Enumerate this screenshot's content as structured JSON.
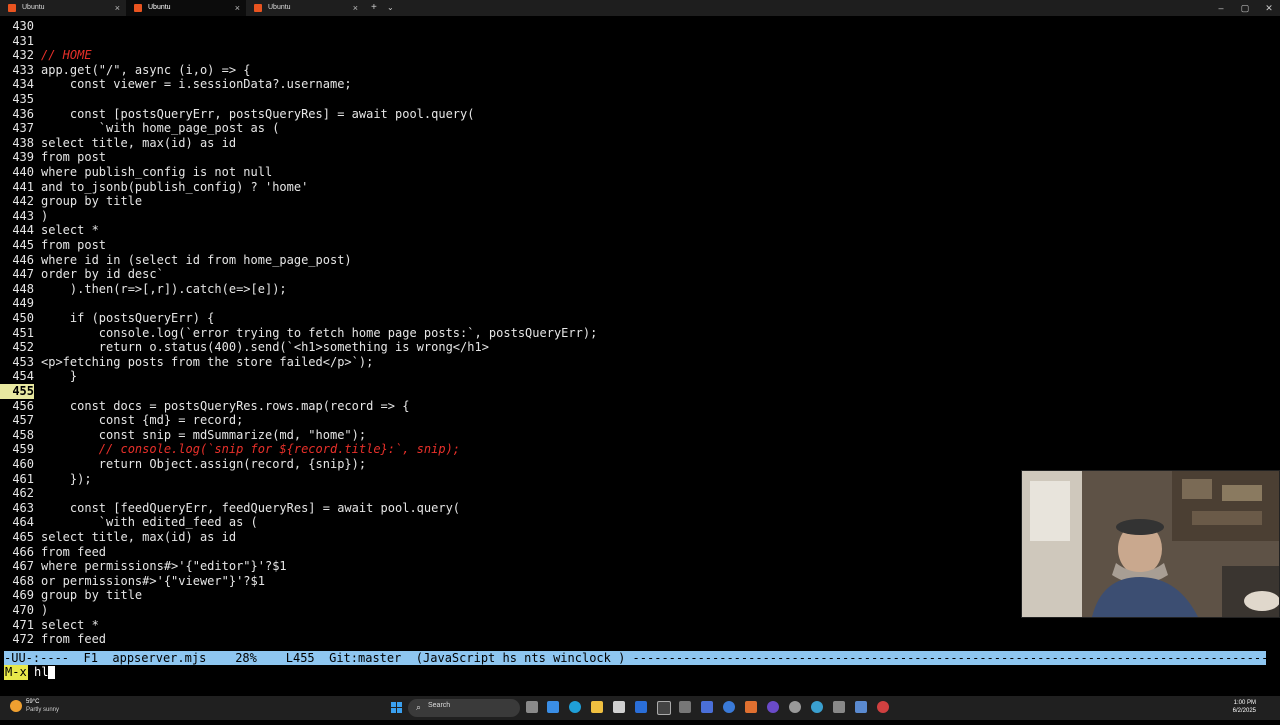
{
  "tabs": [
    {
      "label": "Ubuntu",
      "active": false
    },
    {
      "label": "Ubuntu",
      "active": true
    },
    {
      "label": "Ubuntu",
      "active": false
    }
  ],
  "tabbar": {
    "new_tab": "+",
    "dropdown": "⌄",
    "close": "×"
  },
  "window": {
    "minimize": "–",
    "maximize": "▢",
    "close": "✕"
  },
  "editor": {
    "current_line": "455",
    "lines": [
      {
        "n": "430",
        "code": ""
      },
      {
        "n": "431",
        "code": ""
      },
      {
        "n": "432",
        "code": "// HOME",
        "cls": "comment"
      },
      {
        "n": "433",
        "code": "app.get(\"/\", async (i,o) => {"
      },
      {
        "n": "434",
        "code": "    const viewer = i.sessionData?.username;"
      },
      {
        "n": "435",
        "code": ""
      },
      {
        "n": "436",
        "code": "    const [postsQueryErr, postsQueryRes] = await pool.query("
      },
      {
        "n": "437",
        "code": "        `with home_page_post as ("
      },
      {
        "n": "438",
        "code": "select title, max(id) as id"
      },
      {
        "n": "439",
        "code": "from post"
      },
      {
        "n": "440",
        "code": "where publish_config is not null"
      },
      {
        "n": "441",
        "code": "and to_jsonb(publish_config) ? 'home'"
      },
      {
        "n": "442",
        "code": "group by title"
      },
      {
        "n": "443",
        "code": ")"
      },
      {
        "n": "444",
        "code": "select *"
      },
      {
        "n": "445",
        "code": "from post"
      },
      {
        "n": "446",
        "code": "where id in (select id from home_page_post)"
      },
      {
        "n": "447",
        "code": "order by id desc`"
      },
      {
        "n": "448",
        "code": "    ).then(r=>[,r]).catch(e=>[e]);"
      },
      {
        "n": "449",
        "code": ""
      },
      {
        "n": "450",
        "code": "    if (postsQueryErr) {"
      },
      {
        "n": "451",
        "code": "        console.log(`error trying to fetch home page posts:`, postsQueryErr);"
      },
      {
        "n": "452",
        "code": "        return o.status(400).send(`<h1>something is wrong</h1>"
      },
      {
        "n": "453",
        "code": "<p>fetching posts from the store failed</p>`);"
      },
      {
        "n": "454",
        "code": "    }"
      },
      {
        "n": "455",
        "code": ""
      },
      {
        "n": "456",
        "code": "    const docs = postsQueryRes.rows.map(record => {"
      },
      {
        "n": "457",
        "code": "        const {md} = record;"
      },
      {
        "n": "458",
        "code": "        const snip = mdSummarize(md, \"home\");"
      },
      {
        "n": "459",
        "code": "        // console.log(`snip for ${record.title}:`, snip);",
        "cls": "comment"
      },
      {
        "n": "460",
        "code": "        return Object.assign(record, {snip});"
      },
      {
        "n": "461",
        "code": "    });"
      },
      {
        "n": "462",
        "code": ""
      },
      {
        "n": "463",
        "code": "    const [feedQueryErr, feedQueryRes] = await pool.query("
      },
      {
        "n": "464",
        "code": "        `with edited_feed as ("
      },
      {
        "n": "465",
        "code": "select title, max(id) as id"
      },
      {
        "n": "466",
        "code": "from feed"
      },
      {
        "n": "467",
        "code": "where permissions#>'{\"editor\"}'?$1"
      },
      {
        "n": "468",
        "code": "or permissions#>'{\"viewer\"}'?$1"
      },
      {
        "n": "469",
        "code": "group by title"
      },
      {
        "n": "470",
        "code": ")"
      },
      {
        "n": "471",
        "code": "select *"
      },
      {
        "n": "472",
        "code": "from feed"
      }
    ]
  },
  "modeline": {
    "text": "-UU-:----  F1  appserver.mjs    28%    L455  Git:master  (JavaScript hs nts winclock ) ---------------------------------------------------------------------------------------------------"
  },
  "minibuffer": {
    "prefix": "M-x",
    "input": "hl"
  },
  "taskbar": {
    "weather_temp": "59°C",
    "weather_desc": "Partly sunny",
    "search_label": "Search",
    "time": "1:00 PM",
    "date": "6/2/2025"
  },
  "colors": {
    "comment": "#e8302a",
    "modeline_bg": "#8ec6f0",
    "current_line_bg": "#e8e8a0",
    "minibuffer_prefix_bg": "#e8e84a"
  }
}
